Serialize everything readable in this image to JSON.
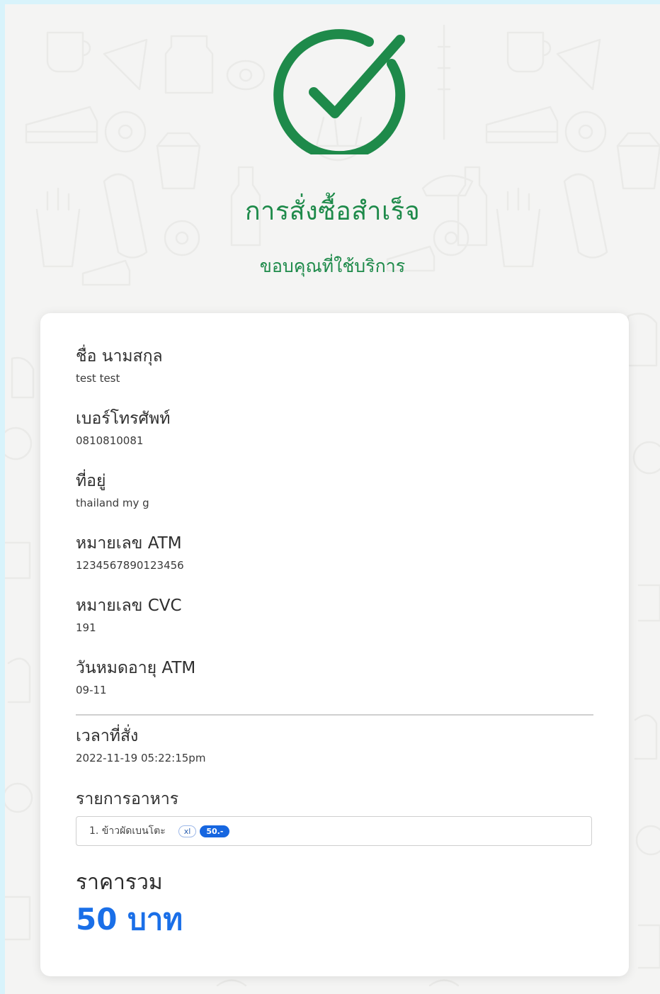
{
  "header": {
    "title": "การสั่งซื้อสำเร็จ",
    "subtitle": "ขอบคุณที่ใช้บริการ",
    "icon": "check-circle-icon"
  },
  "order": {
    "fields": [
      {
        "label": "ชื่อ นามสกุล",
        "value": "test test"
      },
      {
        "label": "เบอร์โทรศัพท์",
        "value": "0810810081"
      },
      {
        "label": "ที่อยู่",
        "value": "thailand my g"
      },
      {
        "label": "หมายเลข ATM",
        "value": "1234567890123456"
      },
      {
        "label": "หมายเลข CVC",
        "value": "191"
      },
      {
        "label": "วันหมดอายุ ATM",
        "value": "09-11"
      }
    ],
    "order_time": {
      "label": "เวลาที่สั่ง",
      "value": "2022-11-19 05:22:15pm"
    },
    "items_label": "รายการอาหาร",
    "items": [
      {
        "name": "1. ข้าวผัดเบนโตะ",
        "size": "xl",
        "price": "50.-"
      }
    ],
    "total_label": "ราคารวม",
    "total_value": "50 บาท"
  },
  "colors": {
    "accent_green": "#1e8a4a",
    "accent_blue": "#1a6fe8",
    "page_bg": "#f4f4f3",
    "frame_bg": "#d8f3fb"
  }
}
